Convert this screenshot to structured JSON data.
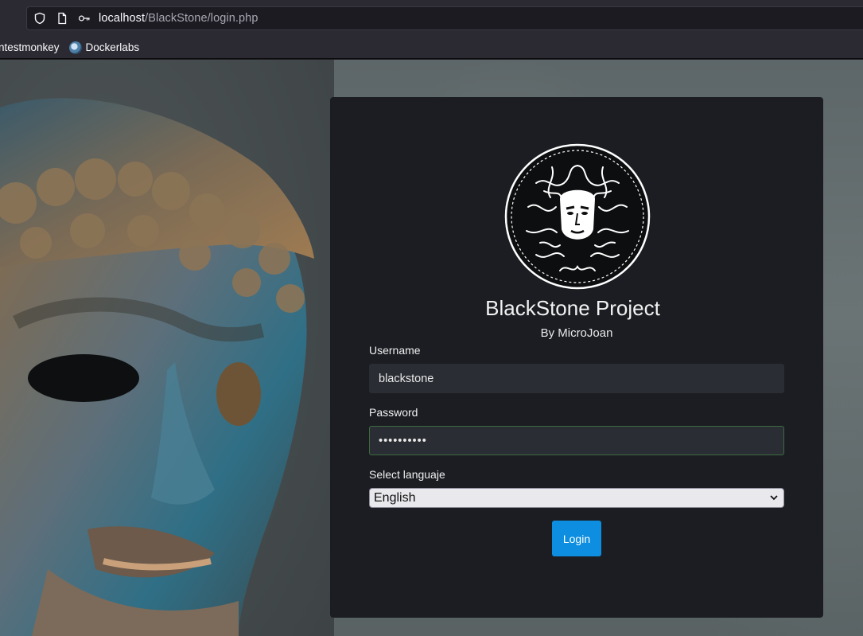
{
  "browser": {
    "url_host": "localhost",
    "url_path": "/BlackStone/login.php",
    "bookmarks": [
      {
        "label": "ntestmonkey"
      },
      {
        "label": "Dockerlabs",
        "icon": "dockerlabs-icon"
      }
    ]
  },
  "login": {
    "title": "BlackStone Project",
    "subtitle": "By MicroJoan",
    "username_label": "Username",
    "username_value": "blackstone",
    "password_label": "Password",
    "password_value": "••••••••••",
    "language_label": "Select languaje",
    "language_selected": "English",
    "submit_label": "Login"
  },
  "colors": {
    "panel_bg": "#1b1d22",
    "button_bg": "#0d8ee0",
    "field_bg": "#2a2d33"
  }
}
